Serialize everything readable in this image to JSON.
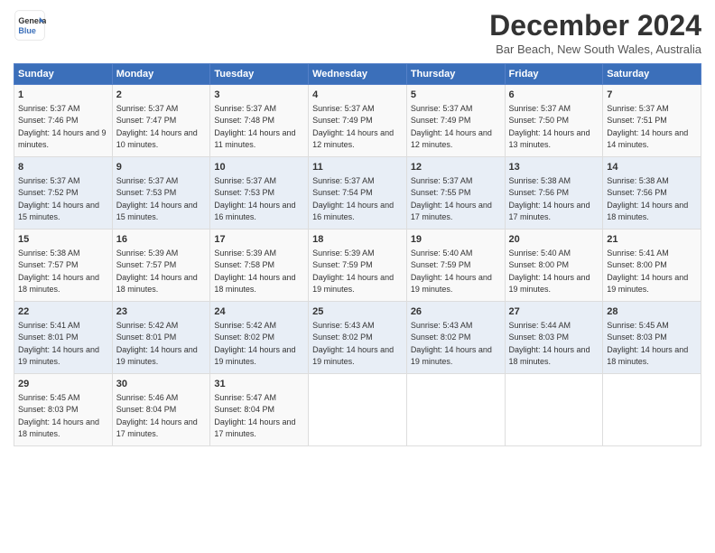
{
  "logo": {
    "line1": "General",
    "line2": "Blue"
  },
  "title": "December 2024",
  "subtitle": "Bar Beach, New South Wales, Australia",
  "days_header": [
    "Sunday",
    "Monday",
    "Tuesday",
    "Wednesday",
    "Thursday",
    "Friday",
    "Saturday"
  ],
  "weeks": [
    [
      {
        "day": "1",
        "sunrise": "5:37 AM",
        "sunset": "7:46 PM",
        "daylight": "14 hours and 9 minutes."
      },
      {
        "day": "2",
        "sunrise": "5:37 AM",
        "sunset": "7:47 PM",
        "daylight": "14 hours and 10 minutes."
      },
      {
        "day": "3",
        "sunrise": "5:37 AM",
        "sunset": "7:48 PM",
        "daylight": "14 hours and 11 minutes."
      },
      {
        "day": "4",
        "sunrise": "5:37 AM",
        "sunset": "7:49 PM",
        "daylight": "14 hours and 12 minutes."
      },
      {
        "day": "5",
        "sunrise": "5:37 AM",
        "sunset": "7:49 PM",
        "daylight": "14 hours and 12 minutes."
      },
      {
        "day": "6",
        "sunrise": "5:37 AM",
        "sunset": "7:50 PM",
        "daylight": "14 hours and 13 minutes."
      },
      {
        "day": "7",
        "sunrise": "5:37 AM",
        "sunset": "7:51 PM",
        "daylight": "14 hours and 14 minutes."
      }
    ],
    [
      {
        "day": "8",
        "sunrise": "5:37 AM",
        "sunset": "7:52 PM",
        "daylight": "14 hours and 15 minutes."
      },
      {
        "day": "9",
        "sunrise": "5:37 AM",
        "sunset": "7:53 PM",
        "daylight": "14 hours and 15 minutes."
      },
      {
        "day": "10",
        "sunrise": "5:37 AM",
        "sunset": "7:53 PM",
        "daylight": "14 hours and 16 minutes."
      },
      {
        "day": "11",
        "sunrise": "5:37 AM",
        "sunset": "7:54 PM",
        "daylight": "14 hours and 16 minutes."
      },
      {
        "day": "12",
        "sunrise": "5:37 AM",
        "sunset": "7:55 PM",
        "daylight": "14 hours and 17 minutes."
      },
      {
        "day": "13",
        "sunrise": "5:38 AM",
        "sunset": "7:56 PM",
        "daylight": "14 hours and 17 minutes."
      },
      {
        "day": "14",
        "sunrise": "5:38 AM",
        "sunset": "7:56 PM",
        "daylight": "14 hours and 18 minutes."
      }
    ],
    [
      {
        "day": "15",
        "sunrise": "5:38 AM",
        "sunset": "7:57 PM",
        "daylight": "14 hours and 18 minutes."
      },
      {
        "day": "16",
        "sunrise": "5:39 AM",
        "sunset": "7:57 PM",
        "daylight": "14 hours and 18 minutes."
      },
      {
        "day": "17",
        "sunrise": "5:39 AM",
        "sunset": "7:58 PM",
        "daylight": "14 hours and 18 minutes."
      },
      {
        "day": "18",
        "sunrise": "5:39 AM",
        "sunset": "7:59 PM",
        "daylight": "14 hours and 19 minutes."
      },
      {
        "day": "19",
        "sunrise": "5:40 AM",
        "sunset": "7:59 PM",
        "daylight": "14 hours and 19 minutes."
      },
      {
        "day": "20",
        "sunrise": "5:40 AM",
        "sunset": "8:00 PM",
        "daylight": "14 hours and 19 minutes."
      },
      {
        "day": "21",
        "sunrise": "5:41 AM",
        "sunset": "8:00 PM",
        "daylight": "14 hours and 19 minutes."
      }
    ],
    [
      {
        "day": "22",
        "sunrise": "5:41 AM",
        "sunset": "8:01 PM",
        "daylight": "14 hours and 19 minutes."
      },
      {
        "day": "23",
        "sunrise": "5:42 AM",
        "sunset": "8:01 PM",
        "daylight": "14 hours and 19 minutes."
      },
      {
        "day": "24",
        "sunrise": "5:42 AM",
        "sunset": "8:02 PM",
        "daylight": "14 hours and 19 minutes."
      },
      {
        "day": "25",
        "sunrise": "5:43 AM",
        "sunset": "8:02 PM",
        "daylight": "14 hours and 19 minutes."
      },
      {
        "day": "26",
        "sunrise": "5:43 AM",
        "sunset": "8:02 PM",
        "daylight": "14 hours and 19 minutes."
      },
      {
        "day": "27",
        "sunrise": "5:44 AM",
        "sunset": "8:03 PM",
        "daylight": "14 hours and 18 minutes."
      },
      {
        "day": "28",
        "sunrise": "5:45 AM",
        "sunset": "8:03 PM",
        "daylight": "14 hours and 18 minutes."
      }
    ],
    [
      {
        "day": "29",
        "sunrise": "5:45 AM",
        "sunset": "8:03 PM",
        "daylight": "14 hours and 18 minutes."
      },
      {
        "day": "30",
        "sunrise": "5:46 AM",
        "sunset": "8:04 PM",
        "daylight": "14 hours and 17 minutes."
      },
      {
        "day": "31",
        "sunrise": "5:47 AM",
        "sunset": "8:04 PM",
        "daylight": "14 hours and 17 minutes."
      },
      null,
      null,
      null,
      null
    ]
  ]
}
